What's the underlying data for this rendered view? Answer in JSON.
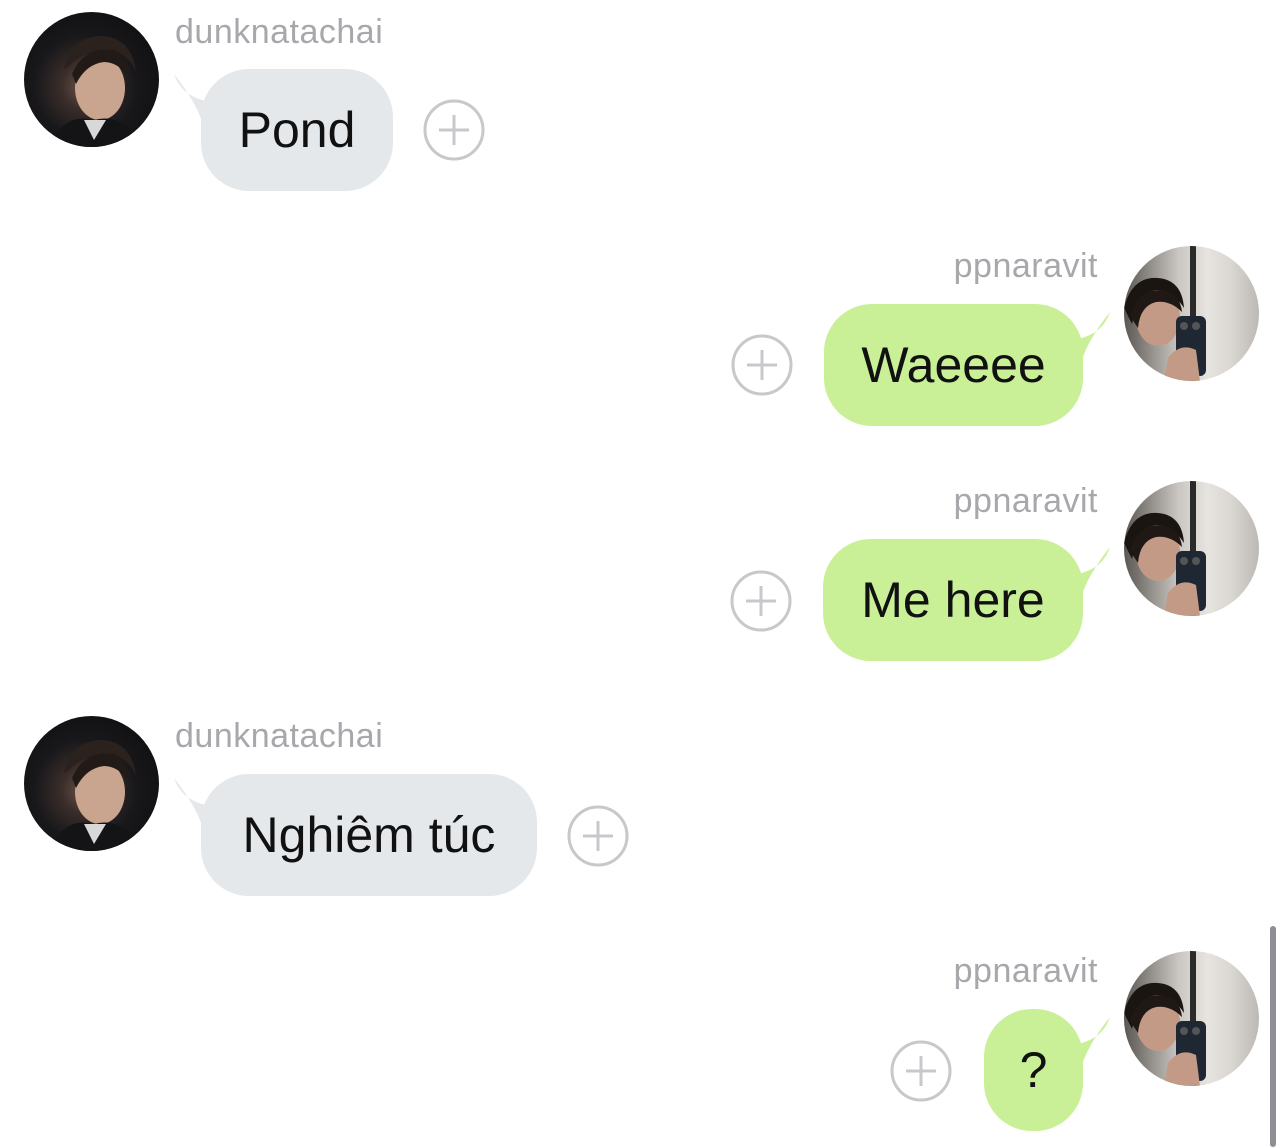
{
  "messages": [
    {
      "sender": "dunknatachai",
      "text": "Pond",
      "direction": "incoming"
    },
    {
      "sender": "ppnaravit",
      "text": "Waeeee",
      "direction": "outgoing"
    },
    {
      "sender": "ppnaravit",
      "text": "Me here",
      "direction": "outgoing"
    },
    {
      "sender": "dunknatachai",
      "text": "Nghiêm túc",
      "direction": "incoming"
    },
    {
      "sender": "ppnaravit",
      "text": "?",
      "direction": "outgoing"
    }
  ],
  "colors": {
    "incoming_bubble": "#e5e8eb",
    "outgoing_bubble": "#c9f096",
    "sender_name": "#a8a8ac",
    "add_reaction_icon": "#c8c8cc"
  },
  "icons": {
    "add_reaction": "plus-circle-icon",
    "avatar": "profile-photo"
  }
}
